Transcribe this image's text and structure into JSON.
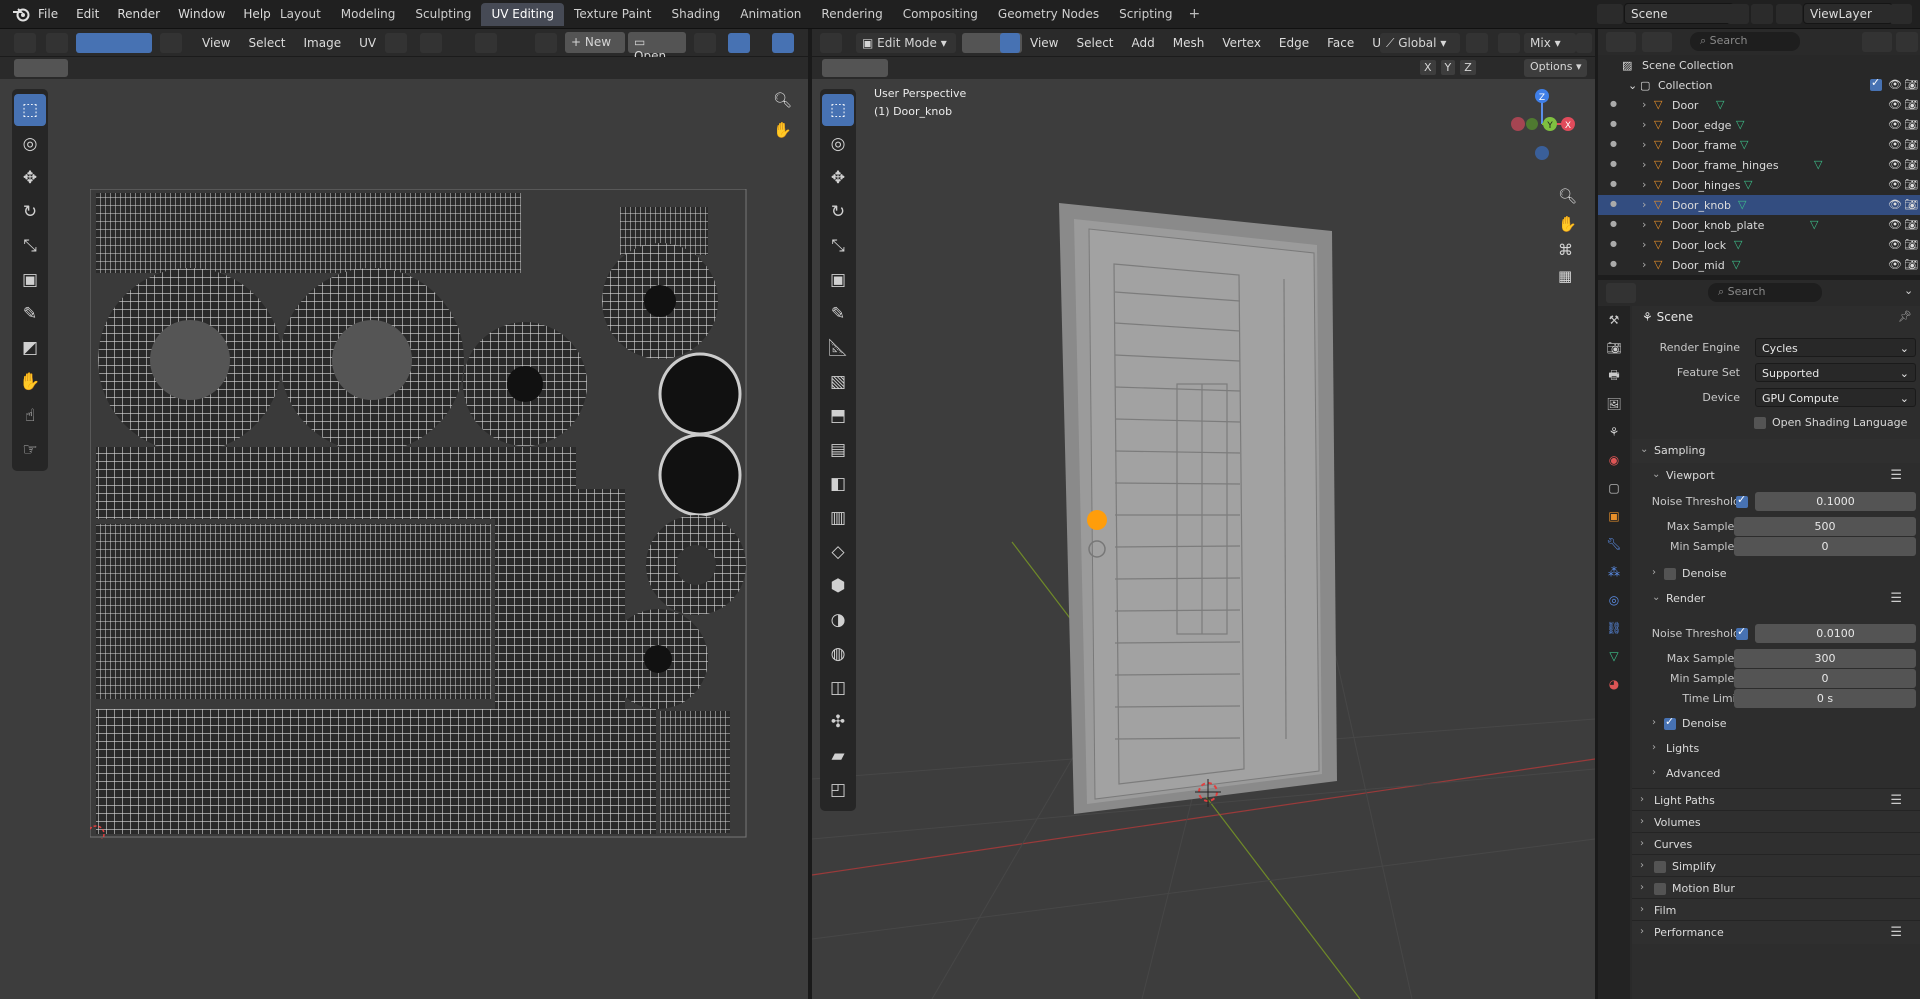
{
  "topbar": {
    "menus": [
      "File",
      "Edit",
      "Render",
      "Window",
      "Help"
    ],
    "workspaces": [
      {
        "label": "Layout",
        "active": false
      },
      {
        "label": "Modeling",
        "active": false
      },
      {
        "label": "Sculpting",
        "active": false
      },
      {
        "label": "UV Editing",
        "active": true
      },
      {
        "label": "Texture Paint",
        "active": false
      },
      {
        "label": "Shading",
        "active": false
      },
      {
        "label": "Animation",
        "active": false
      },
      {
        "label": "Rendering",
        "active": false
      },
      {
        "label": "Compositing",
        "active": false
      },
      {
        "label": "Geometry Nodes",
        "active": false
      },
      {
        "label": "Scripting",
        "active": false
      }
    ],
    "add_workspace": "+",
    "scene": "Scene",
    "view_layer": "ViewLayer"
  },
  "uv_editor": {
    "menus": [
      "View",
      "Select",
      "Image",
      "UV"
    ],
    "new_label": "New",
    "open_label": "Open"
  },
  "viewport3d": {
    "mode": "Edit Mode",
    "menus": [
      "View",
      "Select",
      "Add",
      "Mesh",
      "Vertex",
      "Edge",
      "Face",
      "UV"
    ],
    "orientation": "Global",
    "shading_mix": "Mix",
    "options_label": "Options",
    "axes": [
      "X",
      "Y",
      "Z"
    ],
    "perspective_label": "User Perspective",
    "object_label": "(1) Door_knob",
    "gizmo_axes": {
      "x": "X",
      "y": "Y",
      "z": "Z"
    },
    "accent_color": "#ff9d0a"
  },
  "outliner": {
    "search_placeholder": "Search",
    "scene_collection": "Scene Collection",
    "collection": "Collection",
    "objects": [
      {
        "name": "Door",
        "selected": false
      },
      {
        "name": "Door_edge",
        "selected": false
      },
      {
        "name": "Door_frame",
        "selected": false
      },
      {
        "name": "Door_frame_hinges",
        "selected": false
      },
      {
        "name": "Door_hinges",
        "selected": false
      },
      {
        "name": "Door_knob",
        "selected": true
      },
      {
        "name": "Door_knob_plate",
        "selected": false
      },
      {
        "name": "Door_lock",
        "selected": false
      },
      {
        "name": "Door_mid",
        "selected": false
      }
    ]
  },
  "properties": {
    "search_placeholder": "Search",
    "context": "Scene",
    "render_engine_label": "Render Engine",
    "render_engine": "Cycles",
    "feature_set_label": "Feature Set",
    "feature_set": "Supported",
    "device_label": "Device",
    "device": "GPU Compute",
    "osl_label": "Open Shading Language",
    "sampling_label": "Sampling",
    "viewport_label": "Viewport",
    "viewport_noise_label": "Noise Threshold",
    "viewport_noise": "0.1000",
    "viewport_max_label": "Max Samples",
    "viewport_max": "500",
    "viewport_min_label": "Min Samples",
    "viewport_min": "0",
    "viewport_denoise_label": "Denoise",
    "render_label": "Render",
    "render_noise_label": "Noise Threshold",
    "render_noise": "0.0100",
    "render_max_label": "Max Samples",
    "render_max": "300",
    "render_min_label": "Min Samples",
    "render_min": "0",
    "time_limit_label": "Time Limit",
    "time_limit": "0 s",
    "render_denoise_label": "Denoise",
    "lights_label": "Lights",
    "advanced_label": "Advanced",
    "sections": [
      "Light Paths",
      "Volumes",
      "Curves",
      "Simplify",
      "Motion Blur",
      "Film",
      "Performance"
    ]
  }
}
